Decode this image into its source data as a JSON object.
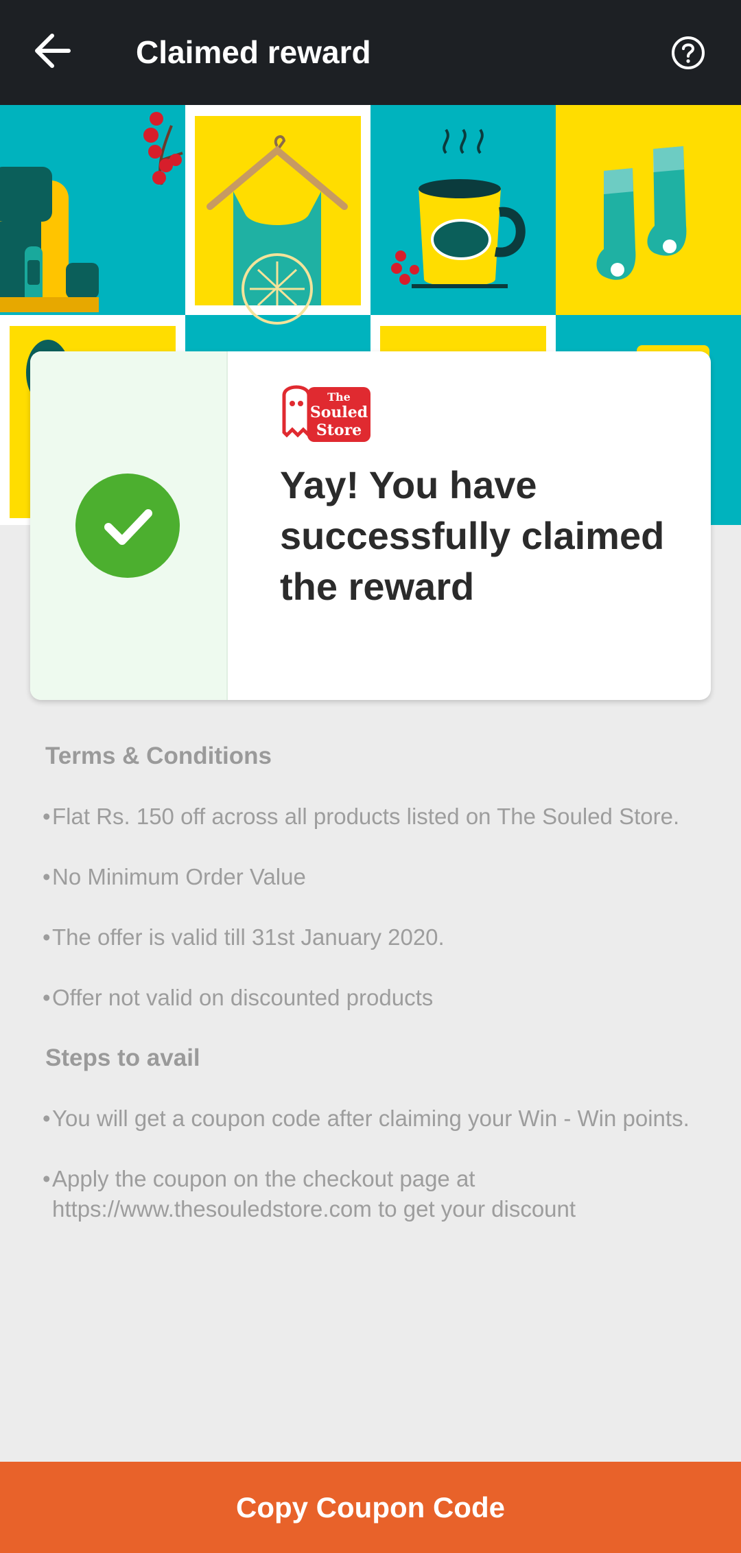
{
  "app_bar": {
    "title": "Claimed reward",
    "back_icon": "arrow-left-icon",
    "help_icon": "question-circle-icon"
  },
  "banner": {
    "illustrations": [
      "backpack",
      "berries",
      "tank-top-on-hanger",
      "steaming-mug",
      "socks"
    ]
  },
  "reward_card": {
    "status_icon": "check-circle-icon",
    "brand_logo_text": "The Souled Store",
    "message": "Yay! You have successfully claimed the reward"
  },
  "terms": {
    "heading": "Terms & Conditions",
    "items": [
      "Flat Rs. 150 off across all products listed on The Souled Store.",
      "No Minimum Order Value",
      "The offer is valid till 31st January 2020.",
      "Offer not valid on discounted products"
    ]
  },
  "steps": {
    "heading": "Steps to avail",
    "items": [
      "You will get a coupon code after claiming your Win - Win points.",
      "Apply the coupon on the checkout page at https://www.thesouledstore.com to get your discount"
    ]
  },
  "footer": {
    "copy_label": "Copy Coupon Code"
  },
  "colors": {
    "app_bar": "#1d2024",
    "teal": "#00b3be",
    "yellow": "#ffdd00",
    "success_green": "#4caf2f",
    "brand_red": "#e02a30",
    "cta_orange": "#e8622a",
    "page_bg": "#ececec"
  }
}
